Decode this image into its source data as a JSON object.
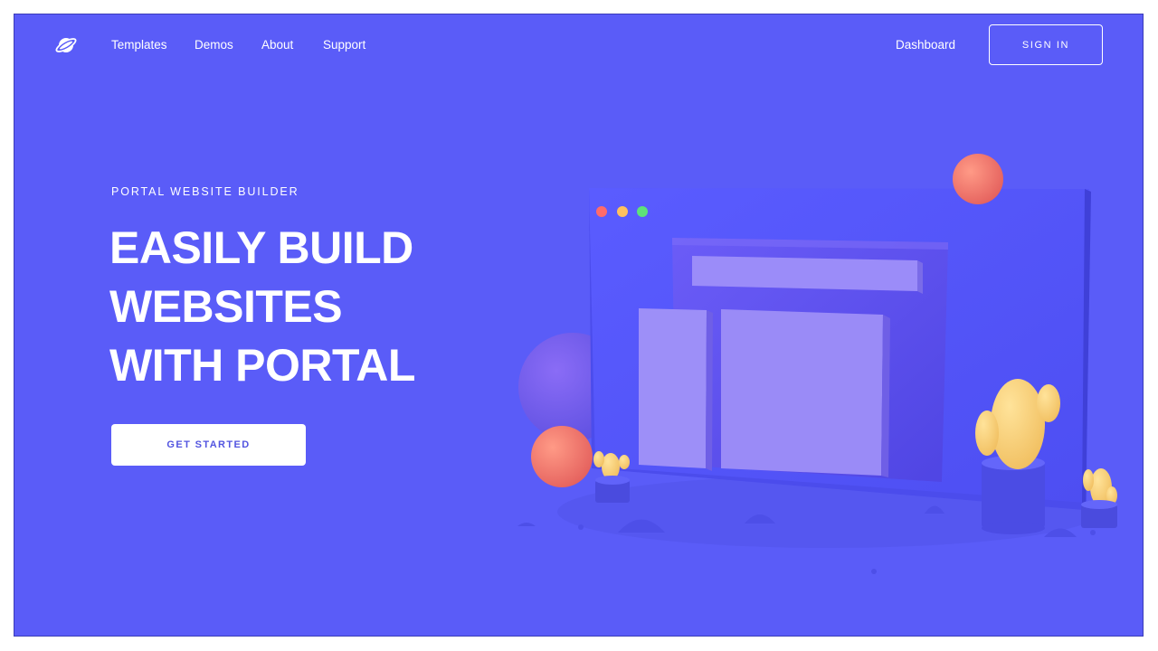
{
  "nav": {
    "logo_icon": "planet-icon",
    "links": [
      "Templates",
      "Demos",
      "About",
      "Support"
    ],
    "dashboard_label": "Dashboard",
    "signin_label": "SIGN IN"
  },
  "hero": {
    "eyebrow": "PORTAL WEBSITE BUILDER",
    "headline_lines": [
      "EASILY BUILD",
      "WEBSITES",
      "WITH PORTAL"
    ],
    "cta_label": "GET STARTED"
  },
  "illustration": {
    "window_dot_colors": [
      "#ff6b6b",
      "#ffc15e",
      "#5ee27a"
    ]
  },
  "colors": {
    "background": "#5a5cf8",
    "accent_text": "#5355e0",
    "sphere_coral": "#f47a6e",
    "cactus_yellow": "#f9d27d"
  }
}
